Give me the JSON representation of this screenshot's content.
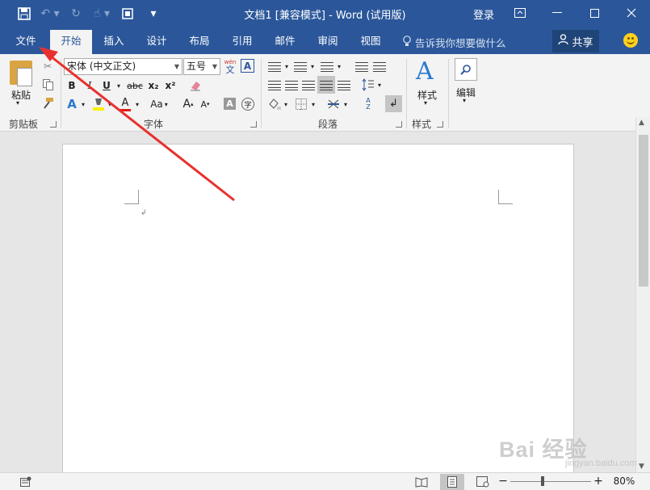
{
  "titlebar": {
    "title": "文档1 [兼容模式] - Word (试用版)",
    "login": "登录",
    "qat": [
      "save-icon",
      "undo-icon",
      "redo-icon",
      "touch-mode-icon",
      "print-preview-icon",
      "customize-qat-icon"
    ]
  },
  "tabs": {
    "file": "文件",
    "home": "开始",
    "insert": "插入",
    "design": "设计",
    "layout": "布局",
    "references": "引用",
    "mailings": "邮件",
    "review": "审阅",
    "view": "视图",
    "tellme": "告诉我你想要做什么",
    "share": "共享"
  },
  "ribbon": {
    "paste": "粘贴",
    "clipboard": "剪贴板",
    "font_name": "宋体 (中文正文)",
    "font_size": "五号",
    "font_group": "字体",
    "paragraph_group": "段落",
    "styles": "样式",
    "styles_group": "样式",
    "editing": "编辑",
    "bold": "B",
    "italic": "I",
    "underline": "U",
    "strike": "abc",
    "subscript": "x₂",
    "superscript": "x²",
    "grow": "A",
    "shrink": "A",
    "case": "Aa",
    "phonetic": "wén",
    "phonetic_char": "文"
  },
  "document": {
    "paragraph_mark": "↲"
  },
  "status": {
    "zoom": "80%",
    "zoom_minus": "−",
    "zoom_plus": "+"
  },
  "watermark": {
    "logo": "Bai 经验",
    "url": "jingyan.baidu.com"
  },
  "colors": {
    "accent": "#2b579a",
    "arrow": "#e8312f"
  }
}
